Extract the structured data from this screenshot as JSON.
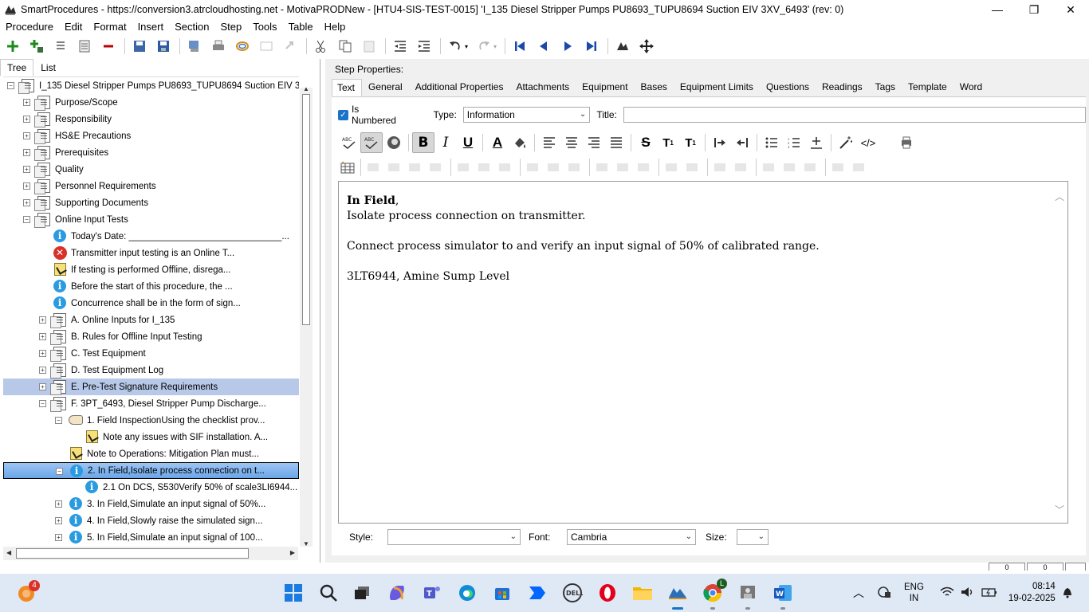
{
  "window": {
    "title": "SmartProcedures - https://conversion3.atrcloudhosting.net - MotivaPRODNew - [HTU4-SIS-TEST-0015] 'I_135 Diesel Stripper Pumps PU8693_TUPU8694 Suction EIV 3XV_6493' (rev: 0)",
    "minimize": "—",
    "restore": "❐",
    "close": "✕"
  },
  "menu": [
    "Procedure",
    "Edit",
    "Format",
    "Insert",
    "Section",
    "Step",
    "Tools",
    "Table",
    "Help"
  ],
  "left": {
    "tabs": [
      "Tree",
      "List"
    ],
    "tree": [
      {
        "label": "I_135  Diesel  Stripper  Pumps  PU8693_TUPU8694  Suction  EIV  3...",
        "icon": "doc",
        "level": 0,
        "exp": "minus"
      },
      {
        "label": "Purpose/Scope",
        "icon": "doc",
        "level": 1,
        "exp": "plus"
      },
      {
        "label": "Responsibility",
        "icon": "doc",
        "level": 1,
        "exp": "plus"
      },
      {
        "label": "HS&E Precautions",
        "icon": "doc",
        "level": 1,
        "exp": "plus"
      },
      {
        "label": "Prerequisites",
        "icon": "doc",
        "level": 1,
        "exp": "plus"
      },
      {
        "label": "Quality",
        "icon": "doc",
        "level": 1,
        "exp": "plus"
      },
      {
        "label": "Personnel Requirements",
        "icon": "doc",
        "level": 1,
        "exp": "plus"
      },
      {
        "label": "Supporting Documents",
        "icon": "doc",
        "level": 1,
        "exp": "plus"
      },
      {
        "label": "Online Input Tests",
        "icon": "doc",
        "level": 1,
        "exp": "minus"
      },
      {
        "label": "Today's Date: ______________________________...",
        "icon": "info",
        "level": 2,
        "exp": ""
      },
      {
        "label": "Transmitter input testing is an Online T...",
        "icon": "error",
        "level": 2,
        "exp": ""
      },
      {
        "label": "If testing is performed Offline, disrega...",
        "icon": "note",
        "level": 2,
        "exp": ""
      },
      {
        "label": "Before the start of this procedure, the ...",
        "icon": "info",
        "level": 2,
        "exp": ""
      },
      {
        "label": "Concurrence shall be in the form of sign...",
        "icon": "info",
        "level": 2,
        "exp": ""
      },
      {
        "label": "A. Online Inputs for I_135",
        "icon": "doc",
        "level": 2,
        "exp": "plus"
      },
      {
        "label": "B. Rules for Offline Input Testing",
        "icon": "doc",
        "level": 2,
        "exp": "plus"
      },
      {
        "label": "C. Test Equipment",
        "icon": "doc",
        "level": 2,
        "exp": "plus"
      },
      {
        "label": "D. Test Equipment Log",
        "icon": "doc",
        "level": 2,
        "exp": "plus"
      },
      {
        "label": "E. Pre-Test Signature Requirements",
        "icon": "doc",
        "level": 2,
        "exp": "plus",
        "sel": "gray"
      },
      {
        "label": "F. 3PT_6493, Diesel Stripper Pump Discharge...",
        "icon": "doc",
        "level": 2,
        "exp": "minus"
      },
      {
        "label": "1. Field InspectionUsing the checklist prov...",
        "icon": "hand",
        "level": 3,
        "exp": "minus"
      },
      {
        "label": "Note any issues with SIF installation. A...",
        "icon": "note",
        "level": 4,
        "exp": ""
      },
      {
        "label": "Note to Operations: Mitigation Plan must...",
        "icon": "note",
        "level": 3,
        "exp": ""
      },
      {
        "label": "2. In Field,Isolate process connection on t...",
        "icon": "info",
        "level": 3,
        "exp": "minus",
        "sel": "blue"
      },
      {
        "label": "2.1 On DCS, S530Verify 50% of scale3LI6944...",
        "icon": "info",
        "level": 4,
        "exp": ""
      },
      {
        "label": "3. In Field,Simulate an input signal of 50%...",
        "icon": "info",
        "level": 3,
        "exp": "plus"
      },
      {
        "label": "4. In Field,Slowly raise the simulated sign...",
        "icon": "info",
        "level": 3,
        "exp": "plus"
      },
      {
        "label": "5. In Field,Simulate an input signal of 100...",
        "icon": "info",
        "level": 3,
        "exp": "plus"
      }
    ]
  },
  "right": {
    "step_properties": "Step Properties:",
    "tabs": [
      "Text",
      "General",
      "Additional Properties",
      "Attachments",
      "Equipment",
      "Bases",
      "Equipment Limits",
      "Questions",
      "Readings",
      "Tags",
      "Template",
      "Word"
    ],
    "is_numbered_label": "Is Numbered",
    "type_label": "Type:",
    "type_value": "Information",
    "title_label": "Title:",
    "title_value": "",
    "editor": {
      "line1_bold": "In Field",
      "line1_rest": ",",
      "line2": "Isolate process connection on transmitter.",
      "line3": "Connect process simulator to and verify an input signal of 50% of calibrated range.",
      "line4": "3LT6944, Amine Sump Level"
    },
    "style_label": "Style:",
    "style_value": "",
    "font_label": "Font:",
    "font_value": "Cambria",
    "size_label": "Size:",
    "size_value": ""
  },
  "status": [
    "0",
    "0"
  ],
  "taskbar": {
    "notif_badge": "4",
    "chrome_badge": "L",
    "lang": "ENG",
    "region": "IN",
    "time": "08:14",
    "date": "19-02-2025"
  }
}
